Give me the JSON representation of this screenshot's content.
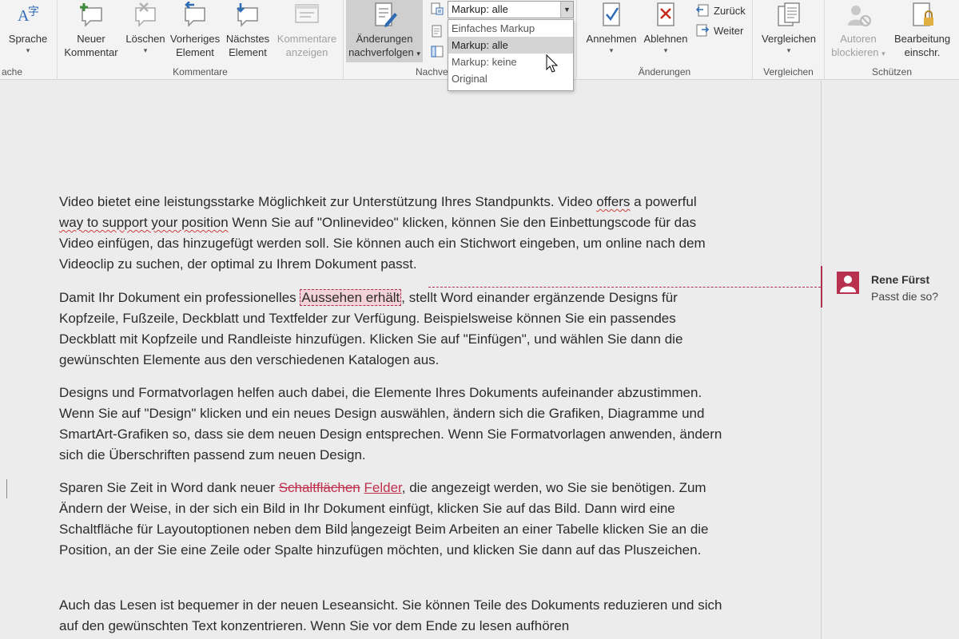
{
  "ribbon": {
    "sprache_label": "Sprache",
    "sprache_group": "ache",
    "comments_group": "Kommentare",
    "new_comment": [
      "Neuer",
      "Kommentar"
    ],
    "delete": "Löschen",
    "previous": [
      "Vorheriges",
      "Element"
    ],
    "next": [
      "Nächstes",
      "Element"
    ],
    "show_comments": [
      "Kommentare",
      "anzeigen"
    ],
    "track_changes": [
      "Änderungen",
      "nachverfolgen"
    ],
    "tracking_group": "Nachve",
    "changes_group": "Änderungen",
    "accept": "Annehmen",
    "reject": "Ablehnen",
    "back": "Zurück",
    "forward": "Weiter",
    "compare": "Vergleichen",
    "compare_group": "Vergleichen",
    "block_authors": [
      "Autoren",
      "blockieren"
    ],
    "restrict_editing": [
      "Bearbeitung",
      "einschr."
    ],
    "protect_group": "Schützen"
  },
  "markup": {
    "current": "Markup: alle",
    "options": [
      "Einfaches Markup",
      "Markup: alle",
      "Markup: keine",
      "Original"
    ],
    "selected_index": 1
  },
  "document": {
    "p1": {
      "a": "Video bietet eine leistungsstarke Möglichkeit zur Unterstützung Ihres Standpunkts. Video ",
      "b": "offers",
      "c": " a powerful ",
      "d": "way to support your position",
      "e": " Wenn Sie auf \"Onlinevideo\" klicken, können Sie den Einbettungscode für das Video einfügen, das hinzugefügt werden soll. Sie können auch ein Stichwort eingeben, um online nach dem Videoclip zu suchen, der optimal zu Ihrem Dokument passt."
    },
    "p2": {
      "a": "Damit Ihr Dokument ein professionelles ",
      "commented": "Aussehen erhält",
      "b": ", stellt Word einander ergänzende Designs für Kopfzeile, Fußzeile, Deckblatt und Textfelder zur Verfügung. Beispielsweise können Sie ein passendes Deckblatt mit Kopfzeile und Randleiste hinzufügen. Klicken Sie auf \"Einfügen\", und wählen Sie dann die gewünschten Elemente aus den verschiedenen Katalogen aus."
    },
    "p3": "Designs und Formatvorlagen helfen auch dabei, die Elemente Ihres Dokuments aufeinander abzustimmen. Wenn Sie auf \"Design\" klicken und ein neues Design auswählen, ändern sich die Grafiken, Diagramme und SmartArt-Grafiken so, dass sie dem neuen Design entsprechen. Wenn Sie Formatvorlagen anwenden, ändern sich die Überschriften passend zum neuen Design.",
    "p4": {
      "a": "Sparen Sie Zeit in Word dank neuer ",
      "deleted": "Schaltflächen",
      "inserted": "Felder",
      "b": ", die angezeigt werden, wo Sie sie benötigen. Zum Ändern der Weise, in der sich ein Bild in Ihr Dokument einfügt, klicken Sie auf das Bild. Dann wird eine Schaltfläche für Layoutoptionen neben dem Bild ",
      "c": "angezeigt Beim Arbeiten an einer Tabelle klicken Sie an die Position, an der Sie eine Zeile oder Spalte hinzufügen möchten, und klicken Sie dann auf das Pluszeichen."
    },
    "p5": "Auch das Lesen ist bequemer in der neuen Leseansicht. Sie können Teile des Dokuments reduzieren und sich auf den gewünschten Text konzentrieren. Wenn Sie vor dem Ende zu lesen aufhören"
  },
  "comment": {
    "author": "Rene Fürst",
    "text": "Passt die so?"
  },
  "colors": {
    "markup_accent": "#b03050",
    "ribbon_bg": "#f3f3f3"
  }
}
